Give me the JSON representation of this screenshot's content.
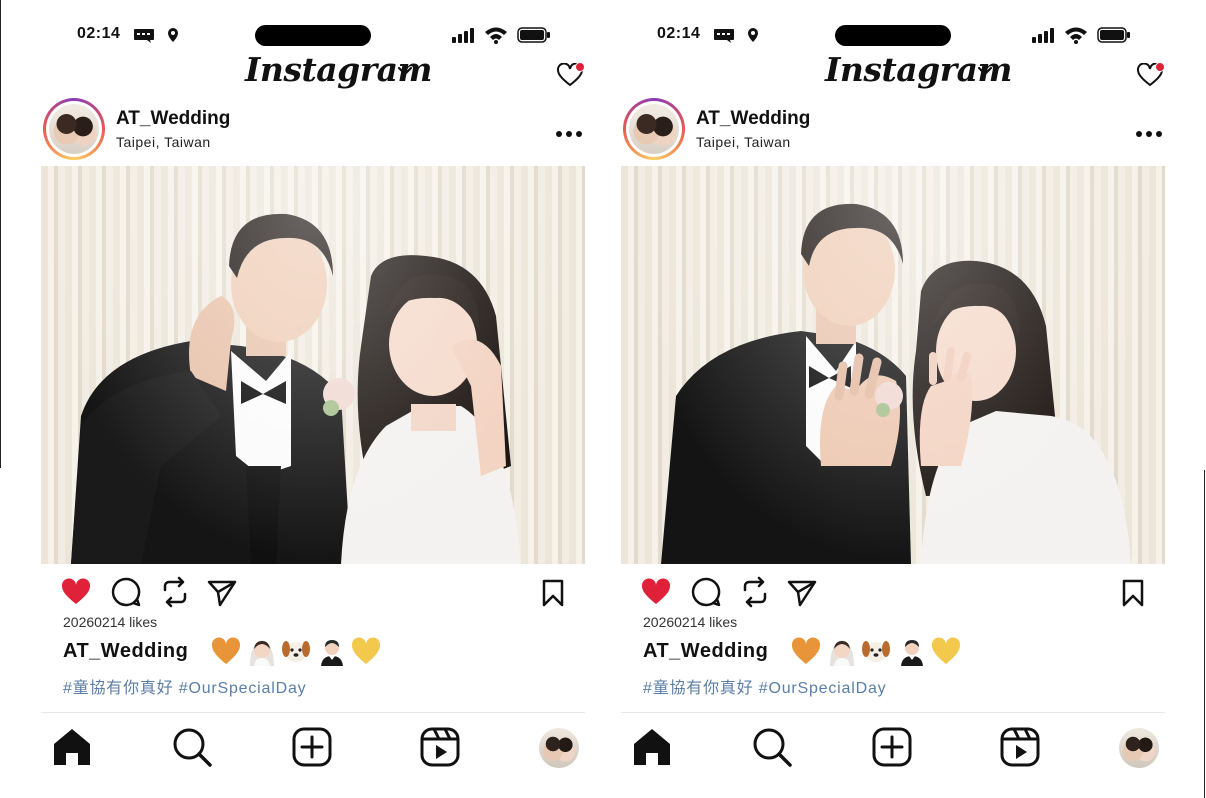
{
  "screens": [
    {
      "status_time": "02:14",
      "app_title": "Instagram",
      "post": {
        "username": "AT_Wedding",
        "location": "Taipei, Taiwan",
        "likes": "20260214 likes",
        "caption_user": "AT_Wedding",
        "caption_emojis": [
          "orange-heart",
          "bride",
          "dog-face",
          "groom",
          "yellow-heart"
        ],
        "hashtags": "#童協有你真好 #OurSpecialDay",
        "liked": true,
        "photo_pose": "heart-hands"
      }
    },
    {
      "status_time": "02:14",
      "app_title": "Instagram",
      "post": {
        "username": "AT_Wedding",
        "location": "Taipei, Taiwan",
        "likes": "20260214 likes",
        "caption_user": "AT_Wedding",
        "caption_emojis": [
          "orange-heart",
          "bride",
          "dog-face",
          "groom",
          "yellow-heart"
        ],
        "hashtags": "#童協有你真好 #OurSpecialDay",
        "liked": true,
        "photo_pose": "showing-rings"
      }
    }
  ],
  "colors": {
    "like_red": "#e0213a",
    "hashtag_blue": "#5b7ea6",
    "orange_heart": "#e8953a",
    "yellow_heart": "#f2c94c"
  }
}
